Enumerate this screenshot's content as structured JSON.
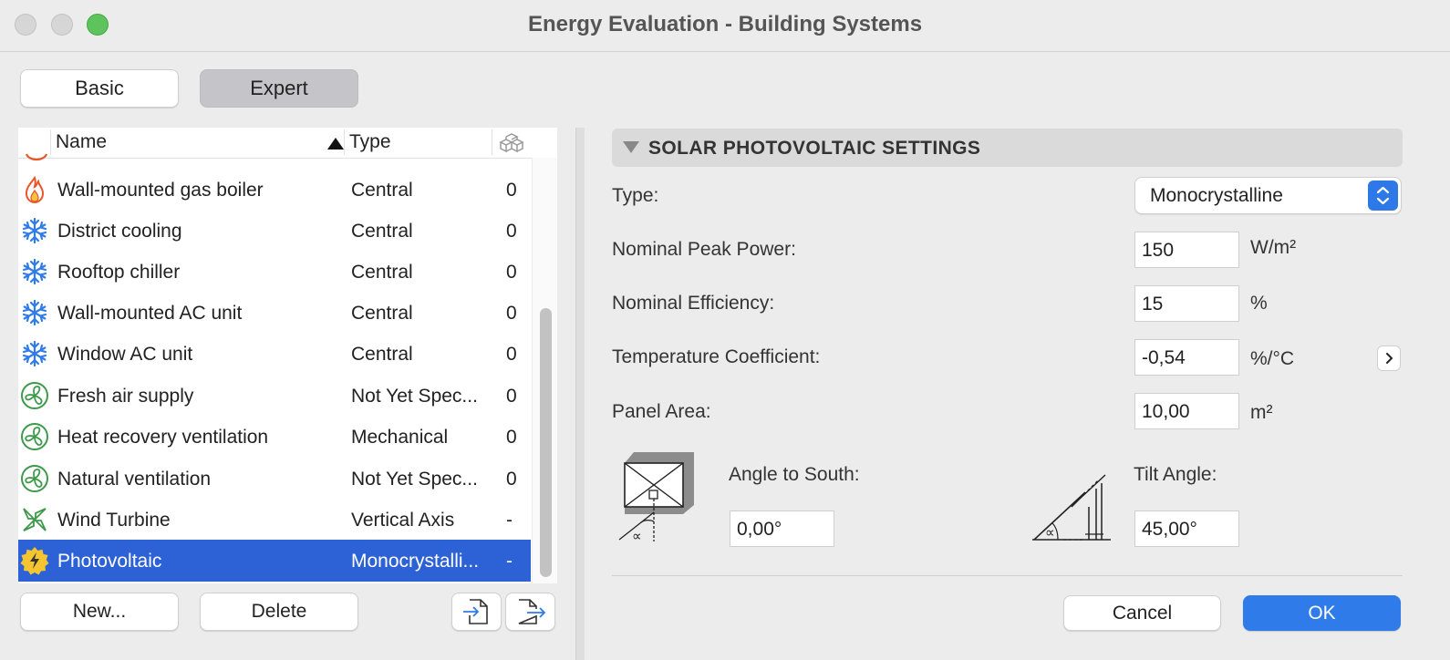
{
  "window": {
    "title": "Energy Evaluation - Building Systems"
  },
  "mode": {
    "basic": "Basic",
    "expert": "Expert",
    "selected": "Expert"
  },
  "list": {
    "columns": {
      "name": "Name",
      "type": "Type"
    },
    "sort": {
      "column": "Name",
      "direction": "ascending"
    },
    "rows": [
      {
        "name": "Wall-mounted gas boiler",
        "type": "Central",
        "count": "0",
        "icon": "flame-icon"
      },
      {
        "name": "District cooling",
        "type": "Central",
        "count": "0",
        "icon": "snowflake-icon"
      },
      {
        "name": "Rooftop chiller",
        "type": "Central",
        "count": "0",
        "icon": "snowflake-icon"
      },
      {
        "name": "Wall-mounted AC unit",
        "type": "Central",
        "count": "0",
        "icon": "snowflake-icon"
      },
      {
        "name": "Window AC unit",
        "type": "Central",
        "count": "0",
        "icon": "snowflake-icon"
      },
      {
        "name": "Fresh air supply",
        "type": "Not Yet Spec...",
        "count": "0",
        "icon": "fan-icon"
      },
      {
        "name": "Heat recovery ventilation",
        "type": "Mechanical",
        "count": "0",
        "icon": "fan-icon"
      },
      {
        "name": "Natural ventilation",
        "type": "Not Yet Spec...",
        "count": "0",
        "icon": "fan-icon"
      },
      {
        "name": "Wind Turbine",
        "type": "Vertical Axis",
        "count": "-",
        "icon": "wind-turbine-icon"
      },
      {
        "name": "Photovoltaic",
        "type": "Monocrystalli...",
        "count": "-",
        "icon": "solar-bolt-icon",
        "selected": true
      }
    ],
    "buttons": {
      "new": "New...",
      "delete": "Delete"
    }
  },
  "settings": {
    "section_title": "SOLAR PHOTOVOLTAIC SETTINGS",
    "type": {
      "label": "Type:",
      "value": "Monocrystalline"
    },
    "peak_power": {
      "label": "Nominal Peak Power:",
      "value": "150",
      "unit": "W/m²"
    },
    "efficiency": {
      "label": "Nominal Efficiency:",
      "value": "15",
      "unit": "%"
    },
    "temp_coeff": {
      "label": "Temperature Coefficient:",
      "value": "-0,54",
      "unit": "%/°C"
    },
    "panel_area": {
      "label": "Panel Area:",
      "value": "10,00",
      "unit": "m²"
    },
    "angle_to_south": {
      "label": "Angle to South:",
      "value": "0,00°"
    },
    "tilt_angle": {
      "label": "Tilt Angle:",
      "value": "45,00°"
    }
  },
  "footer": {
    "cancel": "Cancel",
    "ok": "OK"
  },
  "colors": {
    "accent": "#2f7be9",
    "selection": "#2d62d6",
    "fan_green": "#3d9a4b",
    "snow_blue": "#2f7be9",
    "flame_orange": "#e8562a",
    "sun_yellow": "#f4c531"
  }
}
